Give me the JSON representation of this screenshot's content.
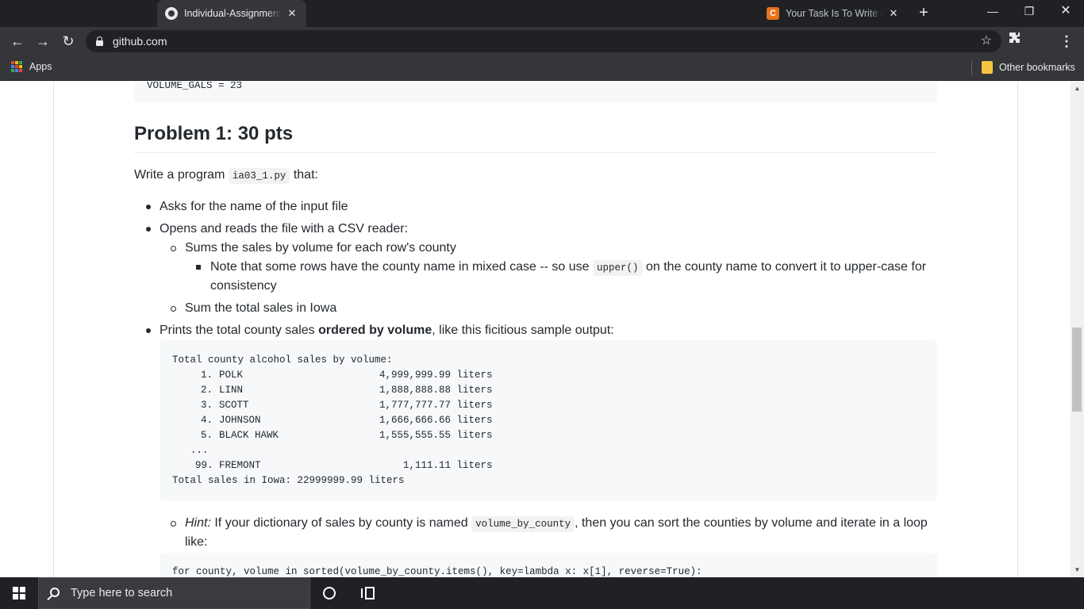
{
  "browser": {
    "tabs": [
      {
        "title": "Individual-Assignments",
        "close": "✕",
        "icon": "github-icon"
      },
      {
        "title": "Your Task Is To Write A",
        "close": "✕",
        "icon": "chegg-icon",
        "icon_letter": "C"
      }
    ],
    "new_tab": "+",
    "window_controls": {
      "minimize": "—",
      "restore": "❐",
      "close": "✕"
    },
    "url": "github.com",
    "nav": {
      "back": "←",
      "forward": "→",
      "reload": "↻"
    },
    "bookmarks_bar": {
      "apps_label": "Apps",
      "other_label": "Other bookmarks"
    },
    "colors": {
      "frame": "#202124",
      "toolbar": "#35363a",
      "text": "#e8eaed"
    }
  },
  "page": {
    "previous_code_line": "VOLUME_GALS = 23",
    "heading": "Problem 1: 30 pts",
    "intro": {
      "before": "Write a program ",
      "code": "ia03_1.py",
      "after": " that:"
    },
    "bullets": {
      "ask": "Asks for the name of the input file",
      "open": "Opens and reads the file with a CSV reader:",
      "sums": "Sums the sales by volume for each row's county",
      "note_before": "Note that some rows have the county name in mixed case -- so use ",
      "note_code": "upper()",
      "note_after": " on the county name to convert it to upper-case for",
      "note_line2": "consistency",
      "sum_total": "Sum the total sales in Iowa",
      "prints_before": "Prints the total county sales ",
      "prints_bold": "ordered by volume",
      "prints_after": ", like this ficitious sample output:"
    },
    "sample_output": {
      "header": "Total county alcohol sales by volume:",
      "rows": [
        {
          "rank": "1.",
          "county": "POLK",
          "volume": "4,999,999.99 liters"
        },
        {
          "rank": "2.",
          "county": "LINN",
          "volume": "1,888,888.88 liters"
        },
        {
          "rank": "3.",
          "county": "SCOTT",
          "volume": "1,777,777.77 liters"
        },
        {
          "rank": "4.",
          "county": "JOHNSON",
          "volume": "1,666,666.66 liters"
        },
        {
          "rank": "5.",
          "county": "BLACK HAWK",
          "volume": "1,555,555.55 liters"
        }
      ],
      "ellipsis": "...",
      "last_row": {
        "rank": "99.",
        "county": "FREMONT",
        "volume": "1,111.11 liters"
      },
      "footer": "Total sales in Iowa: 22999999.99 liters"
    },
    "hint": {
      "label": "Hint:",
      "before": " If your dictionary of sales by county is named ",
      "code": "volume_by_county",
      "after": ", then you can sort the counties by volume and iterate in a loop",
      "line2": "like:"
    },
    "next_code_line": "for county, volume in sorted(volume_by_county.items(), key=lambda x: x[1], reverse=True):"
  },
  "taskbar": {
    "search_placeholder": "Type here to search",
    "icons": [
      "windows-start-icon",
      "search-icon",
      "cortana-icon",
      "task-view-icon"
    ]
  }
}
